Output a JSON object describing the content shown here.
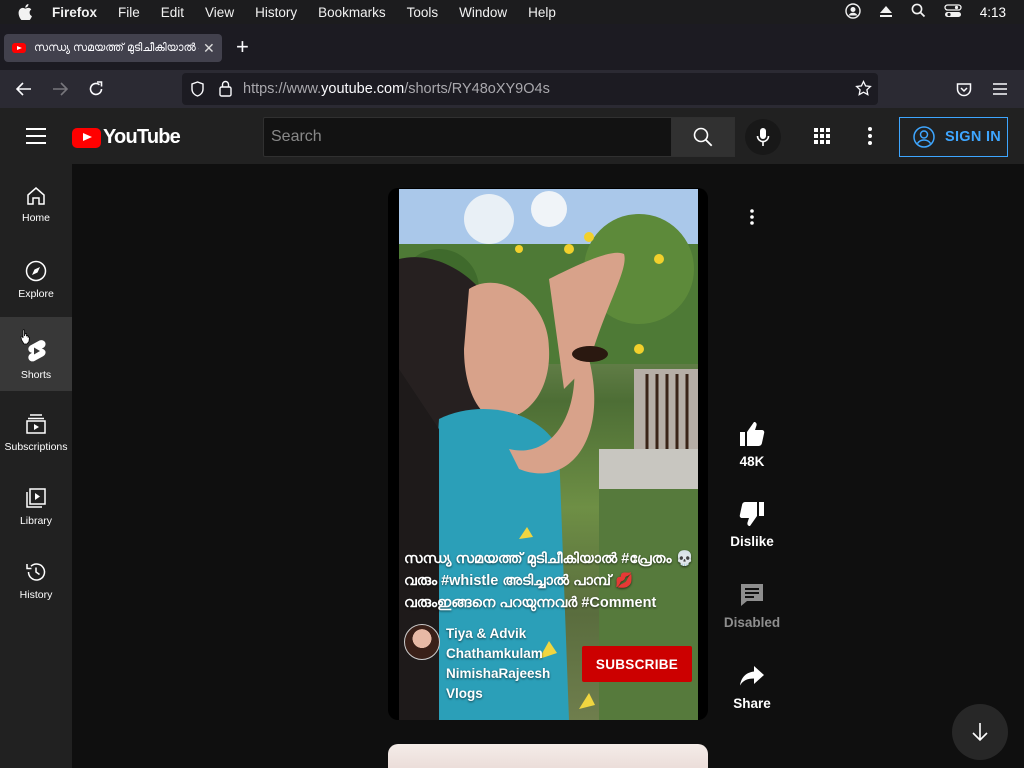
{
  "os_menubar": {
    "app_name": "Firefox",
    "menus": [
      "File",
      "Edit",
      "View",
      "History",
      "Bookmarks",
      "Tools",
      "Window",
      "Help"
    ],
    "clock": "4:13"
  },
  "browser": {
    "tab": {
      "title": "സന്ധ്യ സമയത്ത് മുടിചീകിയാൽ #",
      "favicon": "youtube-icon"
    },
    "url_host_prefix": "https://www.",
    "url_host": "youtube.com",
    "url_path": "/shorts/RY48oXY9O4s"
  },
  "youtube": {
    "logo_text": "YouTube",
    "search_placeholder": "Search",
    "signin_label": "SIGN IN",
    "sidebar": [
      {
        "label": "Home",
        "icon": "home-icon"
      },
      {
        "label": "Explore",
        "icon": "compass-icon"
      },
      {
        "label": "Shorts",
        "icon": "shorts-icon",
        "active": true
      },
      {
        "label": "Subscriptions",
        "icon": "subscriptions-icon"
      },
      {
        "label": "Library",
        "icon": "library-icon"
      },
      {
        "label": "History",
        "icon": "history-icon"
      }
    ],
    "short": {
      "caption": "സന്ധ്യ സമയത്ത് മുടിചീകിയാൽ #പ്രേതം 💀 വരും #whistle അടിച്ചാൽ പാമ്പ് 💋 വരുംഇങ്ങനെ പറയുന്നവർ #Comment",
      "channel_name": "Tiya & Advik Chathamkulam NimishaRajeesh Vlogs",
      "subscribe_label": "SUBSCRIBE",
      "likes": "48K",
      "dislike_label": "Dislike",
      "comments_label": "Disabled",
      "share_label": "Share"
    }
  }
}
